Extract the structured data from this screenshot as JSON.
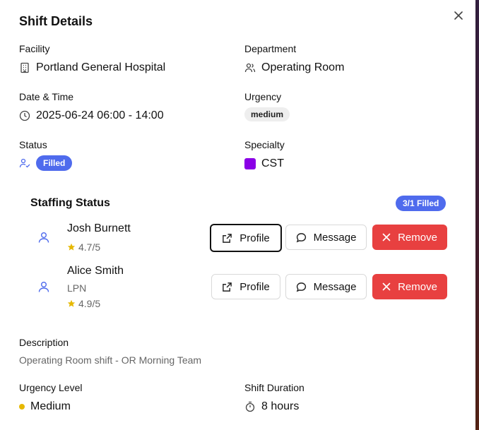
{
  "dialog": {
    "title": "Shift Details"
  },
  "facility": {
    "label": "Facility",
    "value": "Portland General Hospital"
  },
  "department": {
    "label": "Department",
    "value": "Operating Room"
  },
  "datetime": {
    "label": "Date & Time",
    "value": "2025-06-24 06:00 - 14:00"
  },
  "urgency": {
    "label": "Urgency",
    "value": "medium"
  },
  "status": {
    "label": "Status",
    "value": "Filled"
  },
  "specialty": {
    "label": "Specialty",
    "value": "CST",
    "color": "#8a00e6"
  },
  "staffing": {
    "title": "Staffing Status",
    "count_badge": "3/1 Filled",
    "staff": [
      {
        "name": "Josh Burnett",
        "role": "",
        "rating": "4.7/5"
      },
      {
        "name": "Alice Smith",
        "role": "LPN",
        "rating": "4.9/5"
      }
    ],
    "actions": {
      "profile": "Profile",
      "message": "Message",
      "remove": "Remove"
    }
  },
  "description": {
    "label": "Description",
    "text": "Operating Room shift - OR Morning Team"
  },
  "urgency_level": {
    "label": "Urgency Level",
    "value": "Medium",
    "color": "#e6b800"
  },
  "shift_duration": {
    "label": "Shift Duration",
    "value": "8 hours"
  },
  "colors": {
    "primary": "#4f6bed",
    "danger": "#e84040",
    "star": "#e6b800"
  }
}
